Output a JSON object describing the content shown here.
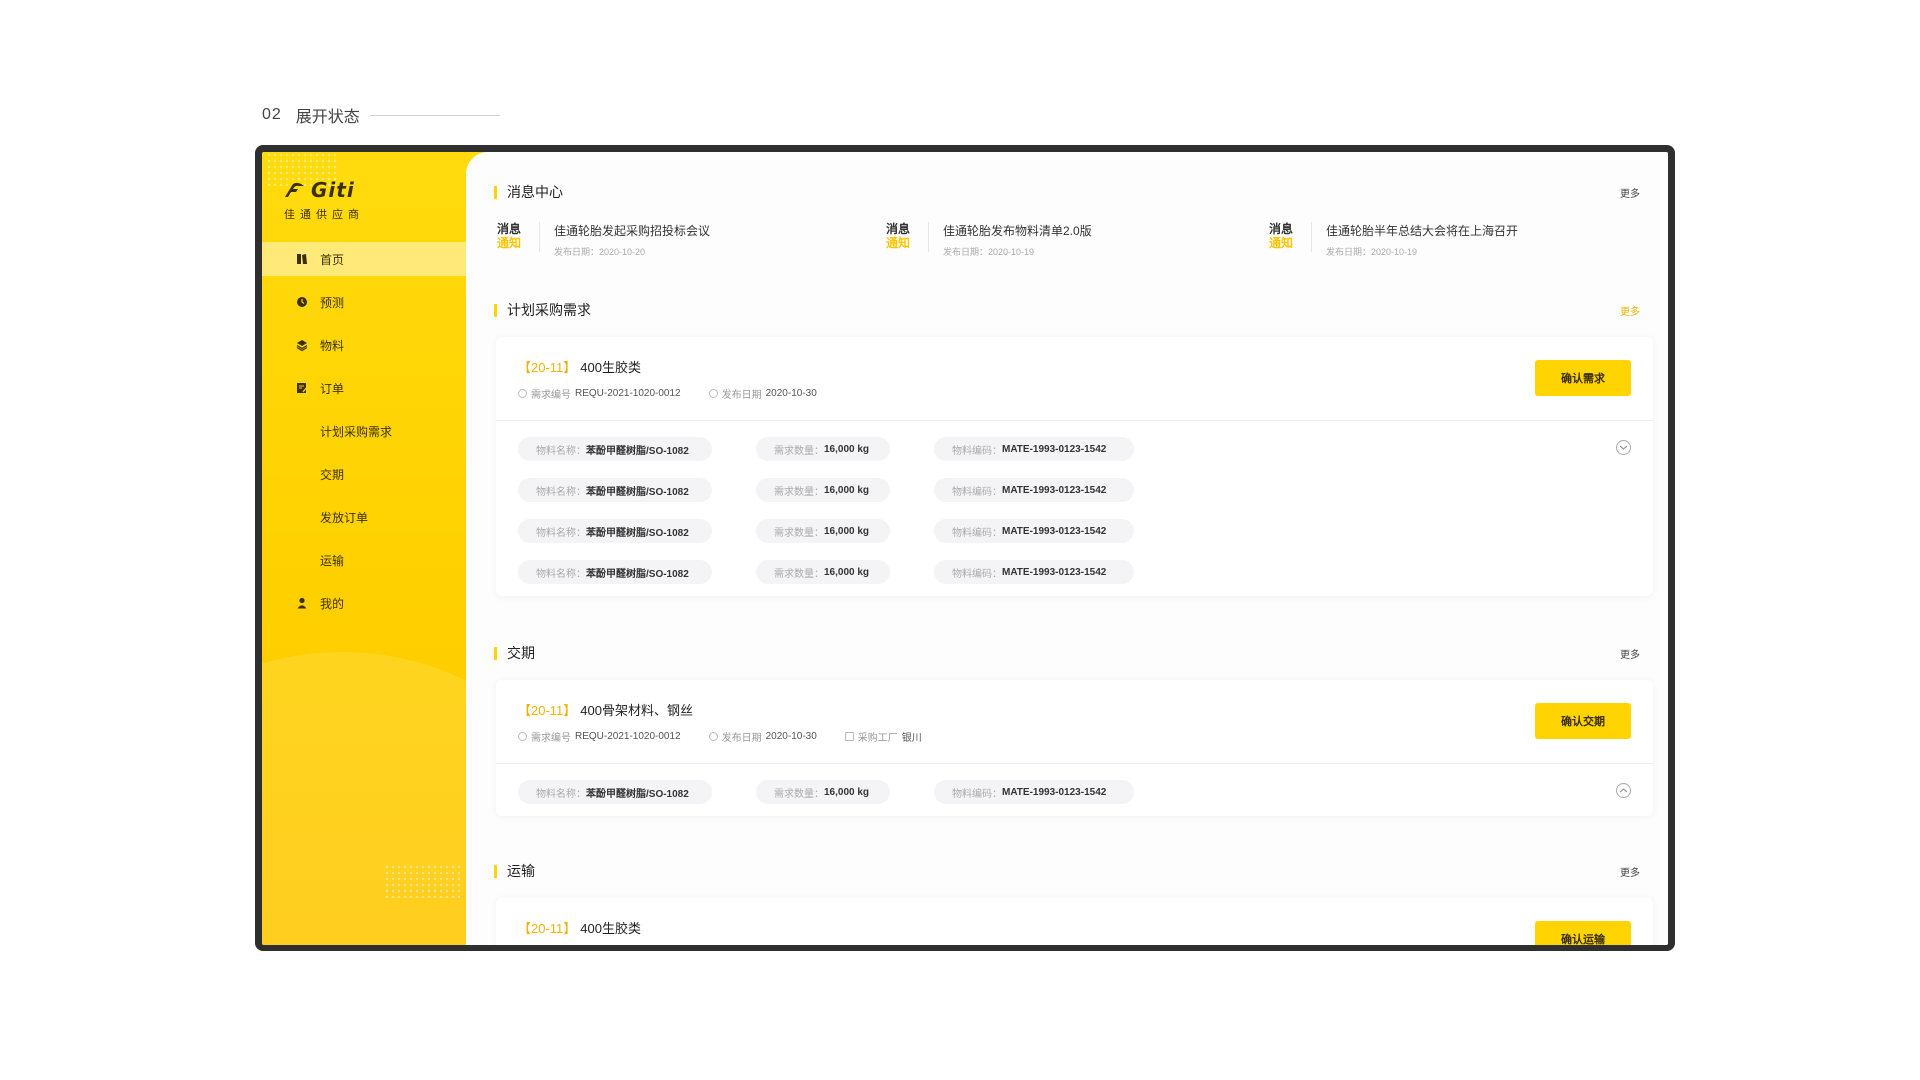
{
  "caption": {
    "number": "02",
    "title": "展开状态"
  },
  "logo": {
    "brand": "Giti",
    "subtitle": "佳通供应商"
  },
  "nav": {
    "home": "首页",
    "forecast": "预测",
    "material": "物料",
    "order": "订单",
    "sub_plan": "计划采购需求",
    "sub_delivery": "交期",
    "sub_release": "发放订单",
    "sub_transport": "运输",
    "mine": "我的"
  },
  "messages": {
    "title": "消息中心",
    "more": "更多",
    "badge_top": "消息",
    "badge_bottom": "通知",
    "items": [
      {
        "title": "佳通轮胎发起采购招投标会议",
        "date_label": "发布日期：",
        "date": "2020-10-20"
      },
      {
        "title": "佳通轮胎发布物料清单2.0版",
        "date_label": "发布日期：",
        "date": "2020-10-19"
      },
      {
        "title": "佳通轮胎半年总结大会将在上海召开",
        "date_label": "发布日期：",
        "date": "2020-10-19"
      }
    ]
  },
  "common": {
    "req_no_label": "需求编号",
    "pub_date_label": "发布日期",
    "factory_label": "采购工厂",
    "mat_name_label": "物料名称：",
    "qty_label": "需求数量：",
    "mat_code_label": "物料编码："
  },
  "plan": {
    "title": "计划采购需求",
    "more": "更多",
    "card": {
      "code": "【20-11】",
      "name": "400生胶类",
      "req_no": "REQU-2021-1020-0012",
      "pub_date": "2020-10-30",
      "button": "确认需求",
      "rows": [
        {
          "name": "苯酚甲醛树脂/SO-1082",
          "qty": "16,000 kg",
          "code": "MATE-1993-0123-1542"
        },
        {
          "name": "苯酚甲醛树脂/SO-1082",
          "qty": "16,000 kg",
          "code": "MATE-1993-0123-1542"
        },
        {
          "name": "苯酚甲醛树脂/SO-1082",
          "qty": "16,000 kg",
          "code": "MATE-1993-0123-1542"
        },
        {
          "name": "苯酚甲醛树脂/SO-1082",
          "qty": "16,000 kg",
          "code": "MATE-1993-0123-1542"
        }
      ]
    }
  },
  "delivery": {
    "title": "交期",
    "more": "更多",
    "card": {
      "code": "【20-11】",
      "name": "400骨架材料、钢丝",
      "req_no": "REQU-2021-1020-0012",
      "pub_date": "2020-10-30",
      "factory": "银川",
      "button": "确认交期",
      "rows": [
        {
          "name": "苯酚甲醛树脂/SO-1082",
          "qty": "16,000 kg",
          "code": "MATE-1993-0123-1542"
        }
      ]
    }
  },
  "transport": {
    "title": "运输",
    "more": "更多",
    "card": {
      "code": "【20-11】",
      "name": "400生胶类",
      "button": "确认运输"
    }
  }
}
